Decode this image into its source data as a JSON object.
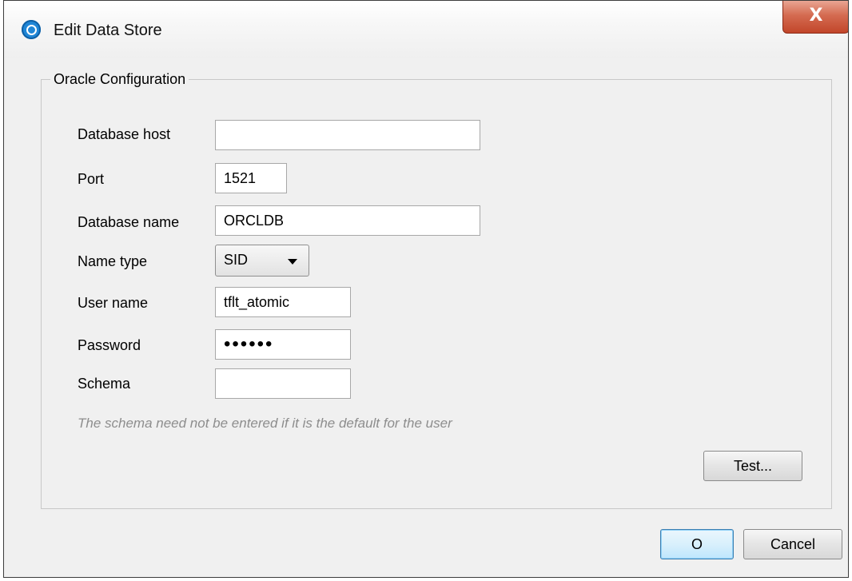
{
  "window": {
    "title": "Edit Data Store",
    "close_label": "X"
  },
  "group": {
    "legend": "Oracle Configuration"
  },
  "form": {
    "host_label": "Database host",
    "host_value": "",
    "port_label": "Port",
    "port_value": "1521",
    "dbname_label": "Database name",
    "dbname_value": "ORCLDB",
    "nametype_label": "Name type",
    "nametype_value": "SID",
    "user_label": "User name",
    "user_value": "tflt_atomic",
    "password_label": "Password",
    "password_value": "••••••",
    "schema_label": "Schema",
    "schema_value": "",
    "schema_hint": "The schema need not be entered if it is the default for the user"
  },
  "buttons": {
    "test": "Test...",
    "ok": "O",
    "cancel": "Cancel"
  },
  "colors": {
    "close_button": "#c2462a",
    "ok_button_border": "#3c7fb1"
  }
}
